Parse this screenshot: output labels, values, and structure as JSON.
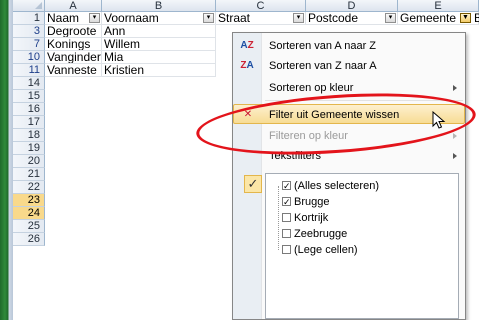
{
  "columns": [
    "A",
    "B",
    "C",
    "D",
    "E"
  ],
  "header_row": {
    "row_number": "1",
    "cells": [
      "Naam",
      "Voornaam",
      "Straat",
      "Postcode",
      "Gemeente",
      "B"
    ]
  },
  "rows": [
    {
      "row_number": "3",
      "naam": "Degroote",
      "voornaam": "Ann"
    },
    {
      "row_number": "7",
      "naam": "Konings",
      "voornaam": "Willem"
    },
    {
      "row_number": "10",
      "naam": "Vanginder",
      "voornaam": "Mia"
    },
    {
      "row_number": "11",
      "naam": "Vanneste",
      "voornaam": "Kristien"
    }
  ],
  "empty_rows": [
    "14",
    "15",
    "16",
    "17",
    "18",
    "19",
    "20",
    "21",
    "22",
    "23",
    "24",
    "25",
    "26"
  ],
  "highlighted_rows": [
    "23",
    "24"
  ],
  "menu": {
    "items": [
      {
        "label": "Sorteren van A naar Z",
        "icon": "sort-az-icon"
      },
      {
        "label": "Sorteren van Z naar A",
        "icon": "sort-za-icon"
      },
      {
        "label": "Sorteren op kleur",
        "icon": ""
      },
      {
        "label": "Filter uit Gemeente wissen",
        "icon": "clear-filter-icon"
      },
      {
        "label": "Filteren op kleur",
        "icon": ""
      },
      {
        "label": "Tekstfilters",
        "icon": ""
      }
    ],
    "list": [
      {
        "label": "(Alles selecteren)",
        "checked": "partial"
      },
      {
        "label": "Brugge",
        "checked": true
      },
      {
        "label": "Kortrijk",
        "checked": false
      },
      {
        "label": "Zeebrugge",
        "checked": false
      },
      {
        "label": "(Lege cellen)",
        "checked": false
      }
    ]
  },
  "colors": {
    "annotation_ellipse": "#e3141b",
    "menu_hover": "#f7dc94",
    "row_header_highlight": "#f9d98b"
  }
}
